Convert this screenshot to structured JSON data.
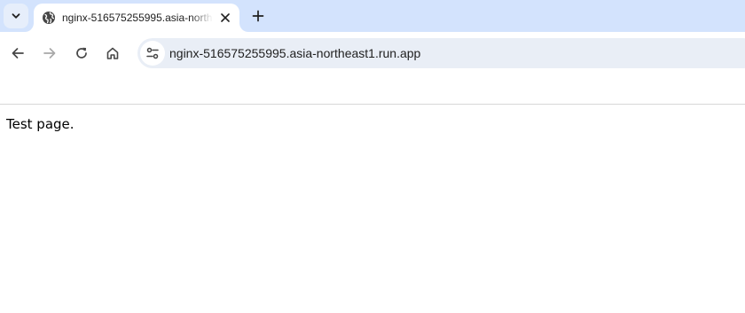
{
  "browser": {
    "tabs": [
      {
        "title": "nginx-516575255995.asia-northeast1.run.app",
        "favicon": "globe-icon",
        "active": true
      }
    ],
    "tab_search_icon": "chevron-down-icon",
    "new_tab_icon": "plus-icon",
    "tab_close_icon": "close-icon"
  },
  "toolbar": {
    "back_icon": "arrow-left-icon",
    "forward_icon": "arrow-right-icon",
    "reload_icon": "reload-icon",
    "home_icon": "home-icon",
    "site_info_icon": "tune-icon",
    "url": "nginx-516575255995.asia-northeast1.run.app"
  },
  "page": {
    "body_text": "Test page."
  },
  "colors": {
    "tabstrip_bg": "#d3e3fd",
    "omnibox_bg": "#e9eef6",
    "icon": "#474747",
    "icon_disabled": "#a8a8a8"
  }
}
